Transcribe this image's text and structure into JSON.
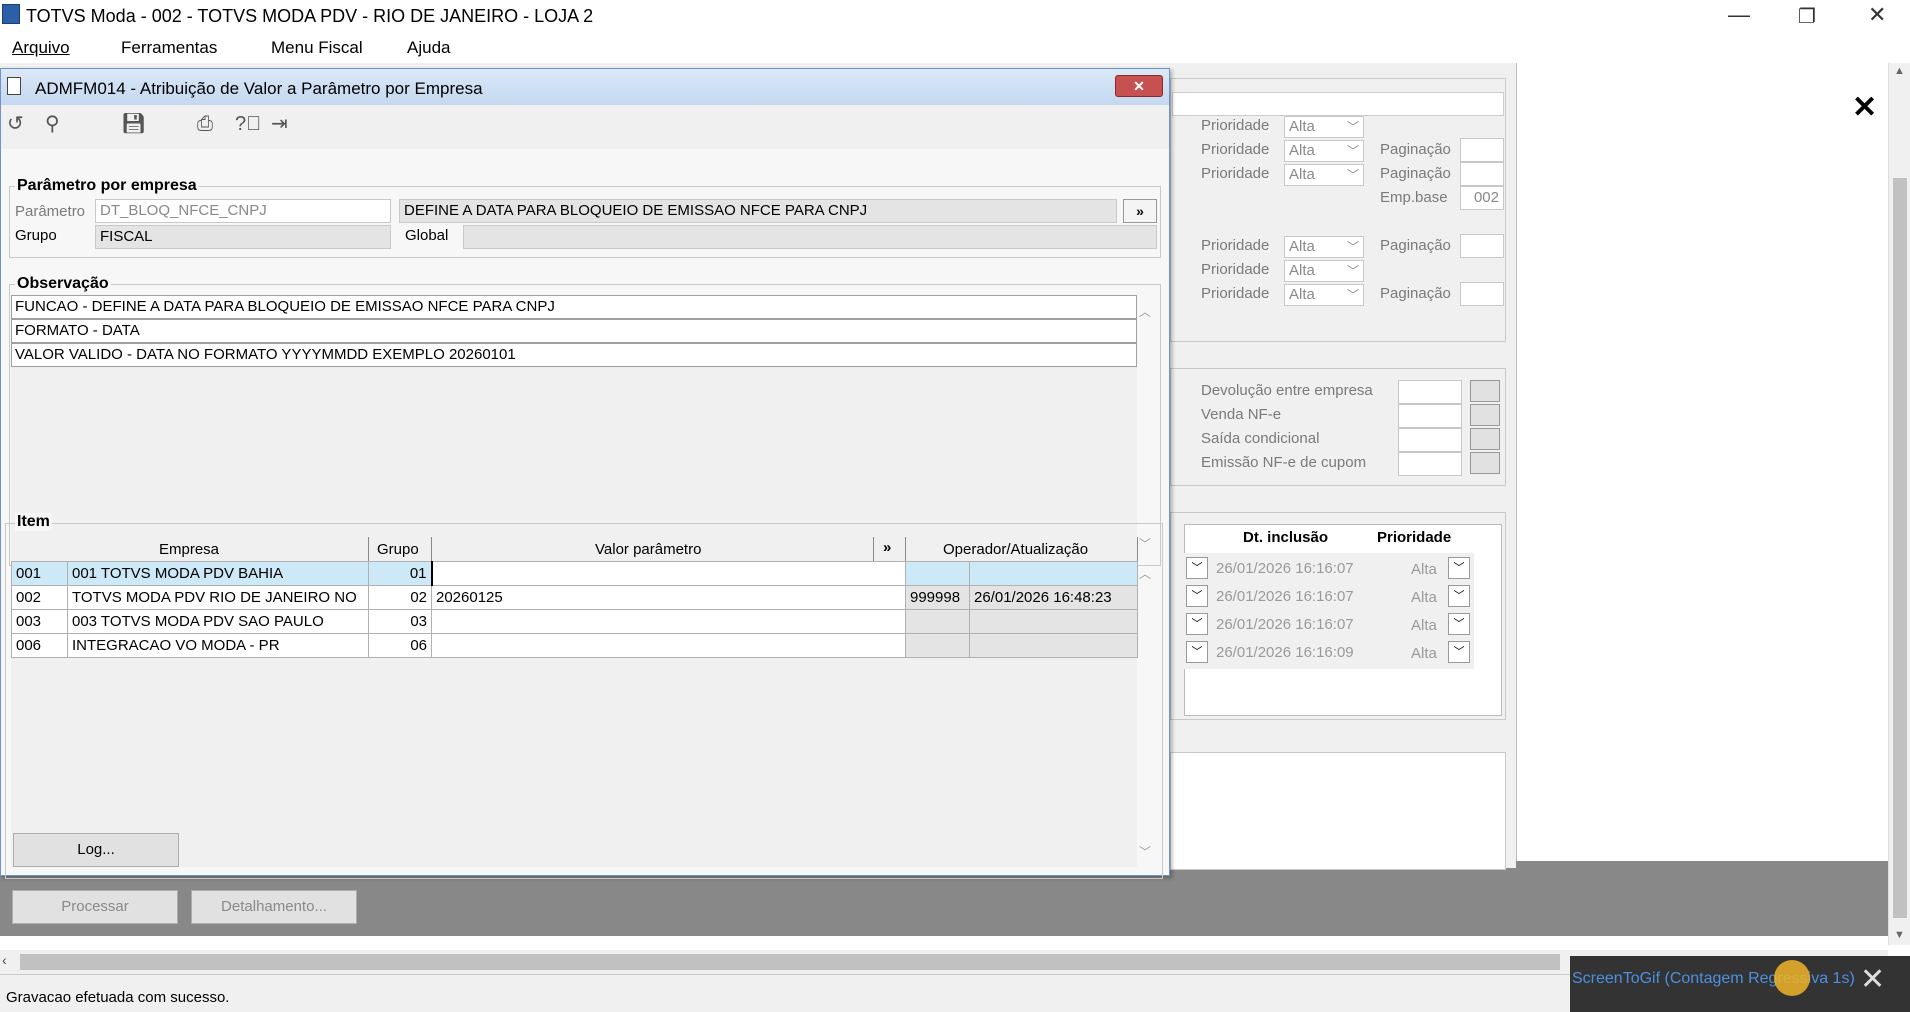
{
  "app": {
    "title": "TOTVS Moda - 002 - TOTVS MODA PDV - RIO DE JANEIRO - LOJA 2",
    "menu": [
      "Arquivo",
      "Ferramentas",
      "Menu Fiscal",
      "Ajuda"
    ]
  },
  "bg": {
    "prioridade_label": "Prioridade",
    "paginacao_label": "Paginação",
    "alta": "Alta",
    "emp_base_label": "Emp.base",
    "emp_base_value": "002",
    "devolucao": "Devolução entre empresa",
    "venda_nfe": "Venda NF-e",
    "saida_cond": "Saída condicional",
    "emissao": "Emissão NF-e de cupom",
    "col_dt": "Dt. inclusão",
    "col_prio": "Prioridade",
    "dates": [
      "26/01/2026 16:16:07",
      "26/01/2026 16:16:07",
      "26/01/2026 16:16:07",
      "26/01/2026 16:16:09"
    ],
    "processar": "Processar",
    "detalhamento": "Detalhamento...",
    "close_x": "✕"
  },
  "dialog": {
    "title": "ADMFM014 - Atribuição de Valor a Parâmetro por Empresa",
    "section_param": "Parâmetro por empresa",
    "parametro_label": "Parâmetro",
    "parametro_value": "DT_BLOQ_NFCE_CNPJ",
    "parametro_desc": "DEFINE A DATA PARA BLOQUEIO DE EMISSAO NFCE PARA CNPJ",
    "grupo_label": "Grupo",
    "grupo_value": "FISCAL",
    "global_label": "Global",
    "section_obs": "Observação",
    "obs_lines": [
      "FUNCAO - DEFINE A DATA PARA BLOQUEIO DE EMISSAO NFCE PARA CNPJ",
      "FORMATO - DATA",
      "VALOR VALIDO - DATA NO FORMATO YYYYMMDD EXEMPLO 20260101"
    ],
    "section_item": "Item",
    "cols": {
      "empresa": "Empresa",
      "grupo": "Grupo",
      "valor": "Valor parâmetro",
      "operador": "Operador/Atualização",
      "expand": "»"
    },
    "rows": [
      {
        "code": "001",
        "name": "001   TOTVS MODA PDV   BAHIA",
        "grupo": "01",
        "valor": "",
        "op": "",
        "dt": ""
      },
      {
        "code": "002",
        "name": "TOTVS MODA PDV   RIO DE JANEIRO   NO",
        "grupo": "02",
        "valor": "20260125",
        "op": "999998",
        "dt": "26/01/2026 16:48:23"
      },
      {
        "code": "003",
        "name": "003   TOTVS MODA PDV   SAO PAULO",
        "grupo": "03",
        "valor": "",
        "op": "",
        "dt": ""
      },
      {
        "code": "006",
        "name": "INTEGRACAO VO MODA - PR",
        "grupo": "06",
        "valor": "",
        "op": "",
        "dt": ""
      }
    ],
    "log_button": "Log..."
  },
  "status": {
    "text": "Gravacao efetuada com sucesso."
  },
  "screentogif": {
    "text": "ScreenToGif (Contagem Regressiva 1s)"
  }
}
